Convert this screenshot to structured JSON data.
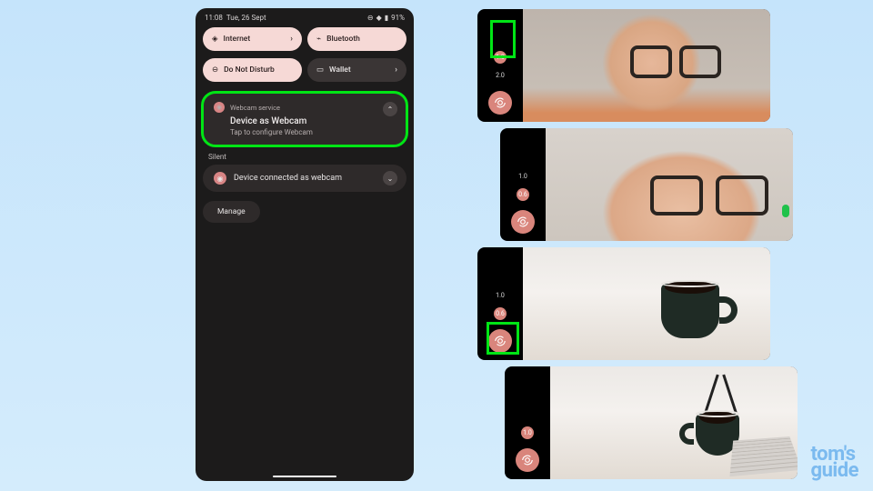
{
  "statusbar": {
    "time": "11:08",
    "date": "Tue, 26 Sept",
    "battery": "91%"
  },
  "qs": {
    "internet": "Internet",
    "bluetooth": "Bluetooth",
    "dnd": "Do Not Disturb",
    "wallet": "Wallet"
  },
  "notif": {
    "service": "Webcam service",
    "title": "Device as Webcam",
    "subtitle": "Tap to configure Webcam"
  },
  "silent": {
    "heading": "Silent",
    "item": "Device connected as webcam"
  },
  "manage": "Manage",
  "webcam_shots": {
    "zoom_options": [
      "1.0",
      "2.0"
    ],
    "shot2_zoom": [
      "1.0",
      "0.6"
    ],
    "shot3_zoom": [
      "1.0",
      "0.6"
    ]
  },
  "watermark": {
    "line1": "tom's",
    "line2": "guide"
  },
  "colors": {
    "highlight": "#00e515",
    "accent": "#d9857c",
    "tilePink": "#f6d9d6"
  }
}
